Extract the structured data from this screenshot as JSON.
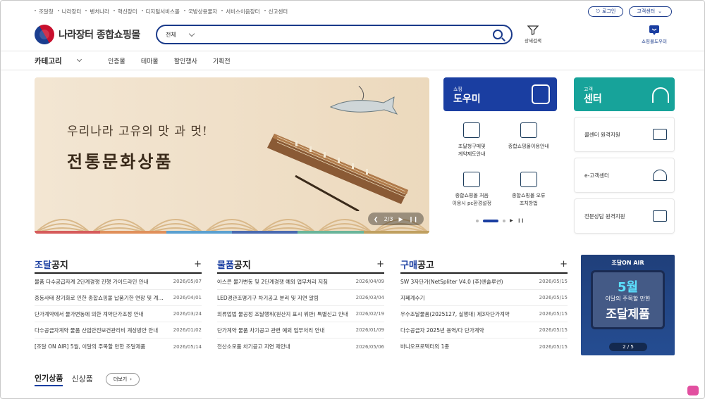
{
  "util": {
    "links": [
      "조달청",
      "나라장터",
      "벤처나라",
      "혁신장터",
      "디지털서비스몰",
      "국방상용물자",
      "서비스이음장터",
      "신고센터"
    ],
    "login": "로그인",
    "support": "고객센터"
  },
  "header": {
    "logo_text": "나라장터 종합쇼핑몰",
    "search_scope": "전체",
    "filter_label": "상세검색",
    "helper_label": "쇼핑몰도우미"
  },
  "nav": {
    "category": "카테고리",
    "items": [
      "인증몰",
      "테마몰",
      "할인행사",
      "기획전"
    ]
  },
  "banner": {
    "line1": "우리나라 고유의 맛 과 멋!",
    "line2": "전통문화상품",
    "page": "2/3"
  },
  "help_panel": {
    "small": "쇼핑",
    "title": "도우미",
    "items": [
      {
        "line1": "조달청구매및",
        "line2": "계약제도안내"
      },
      {
        "line1": "종합쇼핑몰이용안내",
        "line2": ""
      },
      {
        "line1": "종합쇼핑몰 처음",
        "line2": "이용시 pc환경설정"
      },
      {
        "line1": "종합쇼핑몰 오류",
        "line2": "조치방법"
      }
    ]
  },
  "customer": {
    "small": "고객",
    "title": "센터",
    "items": [
      "콜센터 원격지원",
      "e-고객센터",
      "전문상담 원격지원"
    ]
  },
  "notices": [
    {
      "title_hl": "조달",
      "title_rest": "공지",
      "rows": [
        {
          "text": "물품 다수공급자계 2단계경쟁 진행 가이드라인 안내",
          "date": "2026/05/07"
        },
        {
          "text": "중동사태 장기화로 인한 종합쇼핑몰 납품기한 연장 및 계약 예외 안내",
          "date": "2026/04/01"
        },
        {
          "text": "단가계약에서 물가변동에 의한 계약단가조정 안내",
          "date": "2026/03/24"
        },
        {
          "text": "다수공급자계약 물품 산업안전보건관리비 계상방안 안내",
          "date": "2026/01/02"
        },
        {
          "text": "[조달 ON AIR] 5월, 이달의 주목할 만한 조달제품",
          "date": "2026/05/14"
        }
      ]
    },
    {
      "title_hl": "물품",
      "title_rest": "공지",
      "rows": [
        {
          "text": "아스콘 물가변동 및 2단계경쟁 예외 업무처리 지침",
          "date": "2026/04/09"
        },
        {
          "text": "LED경관조명기구 차기공고 분리 및 지연 알림",
          "date": "2026/03/04"
        },
        {
          "text": "의류업법 물공정 조달행위(원산지 표시 위반) 특별신고 안내",
          "date": "2026/02/19"
        },
        {
          "text": "단가계약 물품 차기공고 관련 예외 업무처리 안내",
          "date": "2026/01/09"
        },
        {
          "text": "전산소모품 차기공고 지연 제안내",
          "date": "2026/05/06"
        }
      ]
    },
    {
      "title_hl": "구매",
      "title_rest": "공고",
      "rows": [
        {
          "text": "SW 3자단가(NetSpliter V4.0 (주)엔솔루션)",
          "date": "2026/05/15"
        },
        {
          "text": "지폐계수기",
          "date": "2026/05/15"
        },
        {
          "text": "우수조달물품(2025127, 실행대) 제3자단가계약",
          "date": "2026/05/15"
        },
        {
          "text": "다수공급자 2025년 용역/다 단가계약",
          "date": "2026/05/15"
        },
        {
          "text": "바니오프로텍터외 1종",
          "date": "2026/05/15"
        }
      ]
    }
  ],
  "promo": {
    "brand": "조달ON AIR",
    "month": "5월",
    "subtitle": "이달의 주목할 만한",
    "title": "조달제품",
    "page": "2 / 5"
  },
  "tabs": {
    "active": "인기상품",
    "other": "신상품",
    "more": "더보기"
  },
  "colors": {
    "brand": "#1a3ea1",
    "teal": "#17a39a"
  }
}
